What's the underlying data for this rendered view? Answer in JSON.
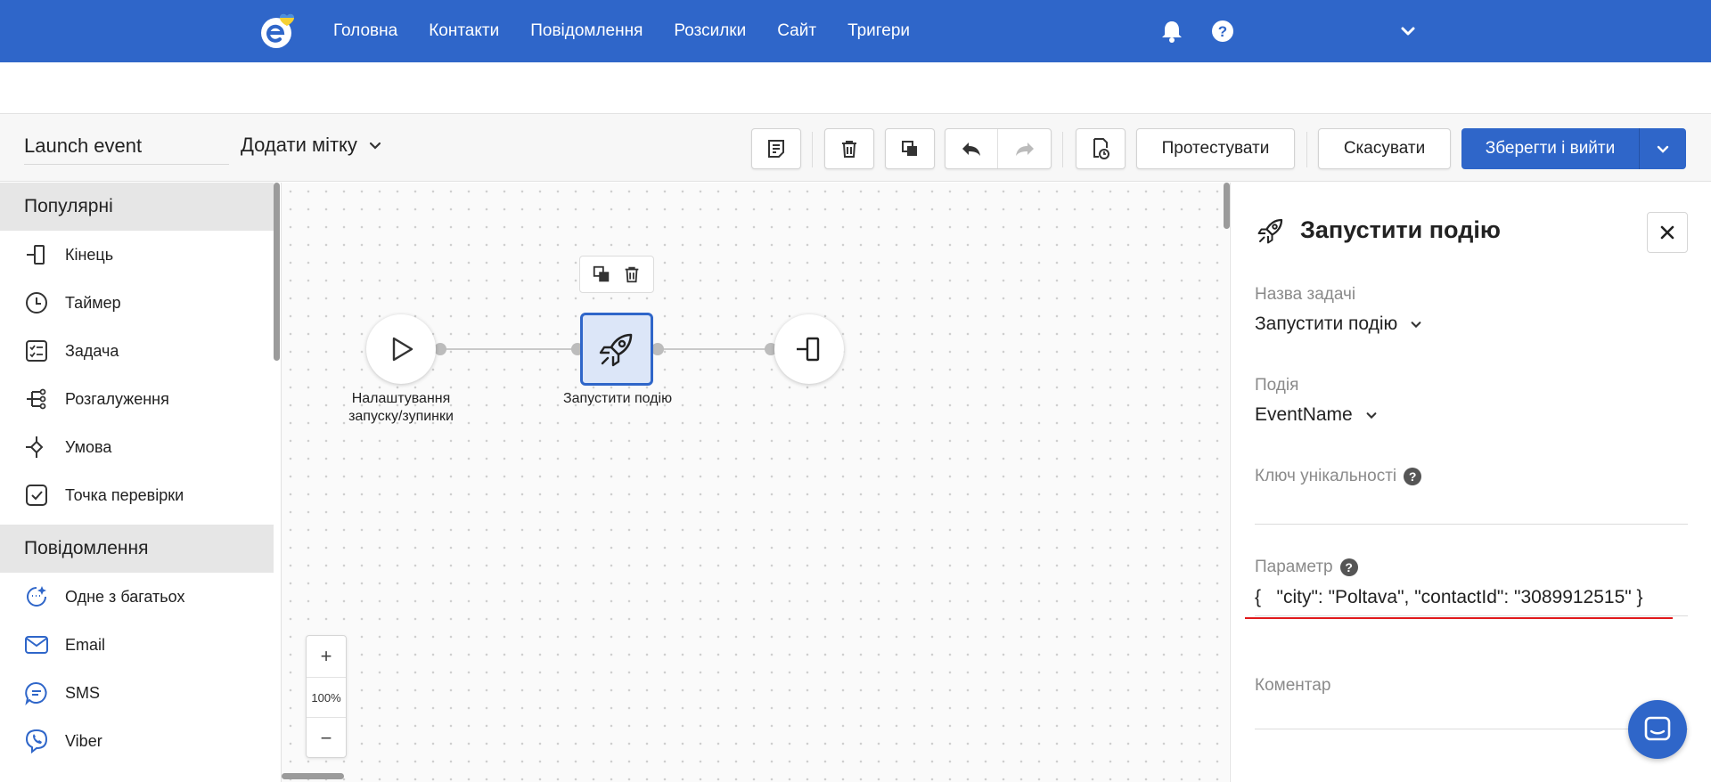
{
  "colors": {
    "brand": "#2f66c9",
    "danger_underline": "#e0191c",
    "selected_node_bg": "#dce6f8"
  },
  "nav": {
    "items": [
      "Головна",
      "Контакти",
      "Повідомлення",
      "Розсилки",
      "Сайт",
      "Тригери"
    ],
    "icons": [
      "bell-icon",
      "help-icon",
      "chevron-down-icon"
    ]
  },
  "toolbar": {
    "name": "Launch event",
    "add_tag": "Додати мітку",
    "test_label": "Протестувати",
    "cancel_label": "Скасувати",
    "save_label": "Зберегти і вийти",
    "icons": [
      "notes-icon",
      "trash-icon",
      "copy-icon",
      "undo-icon",
      "redo-icon",
      "history-icon"
    ]
  },
  "sidebar": {
    "sections": [
      {
        "title": "Популярні",
        "items": [
          {
            "label": "Кінець",
            "icon": "end-icon"
          },
          {
            "label": "Таймер",
            "icon": "timer-icon"
          },
          {
            "label": "Задача",
            "icon": "task-icon"
          },
          {
            "label": "Розгалуження",
            "icon": "branch-icon"
          },
          {
            "label": "Умова",
            "icon": "condition-icon"
          },
          {
            "label": "Точка перевірки",
            "icon": "checkpoint-icon"
          }
        ]
      },
      {
        "title": "Повідомлення",
        "items": [
          {
            "label": "Одне з багатьох",
            "icon": "sparkle-icon"
          },
          {
            "label": "Email",
            "icon": "email-icon"
          },
          {
            "label": "SMS",
            "icon": "sms-icon"
          },
          {
            "label": "Viber",
            "icon": "viber-icon"
          }
        ]
      }
    ]
  },
  "canvas": {
    "nodes": [
      {
        "label_line1": "Налаштування",
        "label_line2": "запуску/зупинки",
        "icon": "play-icon"
      },
      {
        "label": "Запустити подію",
        "icon": "rocket-icon",
        "selected": true
      },
      {
        "icon": "end-icon"
      }
    ],
    "zoom": {
      "plus": "+",
      "value": "100%",
      "minus": "−"
    }
  },
  "panel": {
    "title": "Запустити подію",
    "fields": {
      "task_name_label": "Назва задачі",
      "task_name_value": "Запустити подію",
      "event_label": "Подія",
      "event_value": "EventName",
      "unique_key_label": "Ключ унікальності",
      "param_label": "Параметр",
      "param_value": "{   \"city\": \"Poltava\", \"contactId\": \"3089912515\" }",
      "comment_label": "Коментар"
    }
  }
}
